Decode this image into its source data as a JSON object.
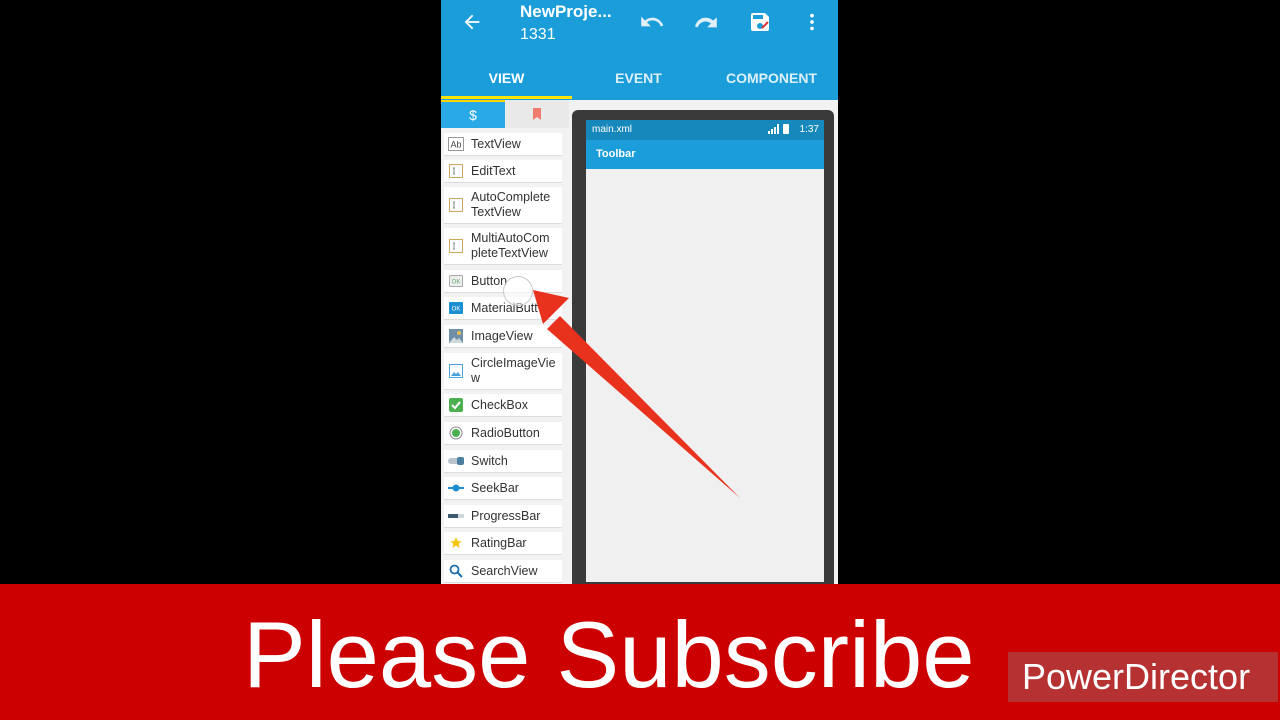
{
  "app": {
    "title": "NewProje...",
    "subtitle": "1331",
    "tabs": [
      "VIEW",
      "EVENT",
      "COMPONENT"
    ],
    "active_tab": "VIEW",
    "icons": [
      "back-arrow-icon",
      "undo-icon",
      "redo-icon",
      "save-icon",
      "more-vert-icon"
    ],
    "accent_color": "#1a9dd9"
  },
  "palette": {
    "tabs": [
      "widgets-icon",
      "bookmark-icon"
    ],
    "items": [
      {
        "label": "TextView",
        "icon": "textview-icon"
      },
      {
        "label": "EditText",
        "icon": "edittext-icon"
      },
      {
        "label": "AutoComplete TextView",
        "icon": "autocomplete-icon"
      },
      {
        "label": "MultiAutoCom pleteTextView",
        "icon": "multiautocomplete-icon"
      },
      {
        "label": "Button",
        "icon": "button-icon"
      },
      {
        "label": "MaterialButt",
        "icon": "material-button-icon"
      },
      {
        "label": "ImageView",
        "icon": "imageview-icon"
      },
      {
        "label": "CircleImageVie w",
        "icon": "circleimageview-icon"
      },
      {
        "label": "CheckBox",
        "icon": "checkbox-icon"
      },
      {
        "label": "RadioButton",
        "icon": "radiobutton-icon"
      },
      {
        "label": "Switch",
        "icon": "switch-icon"
      },
      {
        "label": "SeekBar",
        "icon": "seekbar-icon"
      },
      {
        "label": "ProgressBar",
        "icon": "progressbar-icon"
      },
      {
        "label": "RatingBar",
        "icon": "ratingbar-icon"
      },
      {
        "label": "SearchView",
        "icon": "searchview-icon"
      }
    ]
  },
  "preview": {
    "file_name": "main.xml",
    "time": "1:37",
    "toolbar_label": "Toolbar"
  },
  "overlay": {
    "banner_text": "Please Subscribe",
    "watermark": "PowerDirector",
    "banner_color": "#cc0000",
    "arrow_color": "#e8321e"
  }
}
